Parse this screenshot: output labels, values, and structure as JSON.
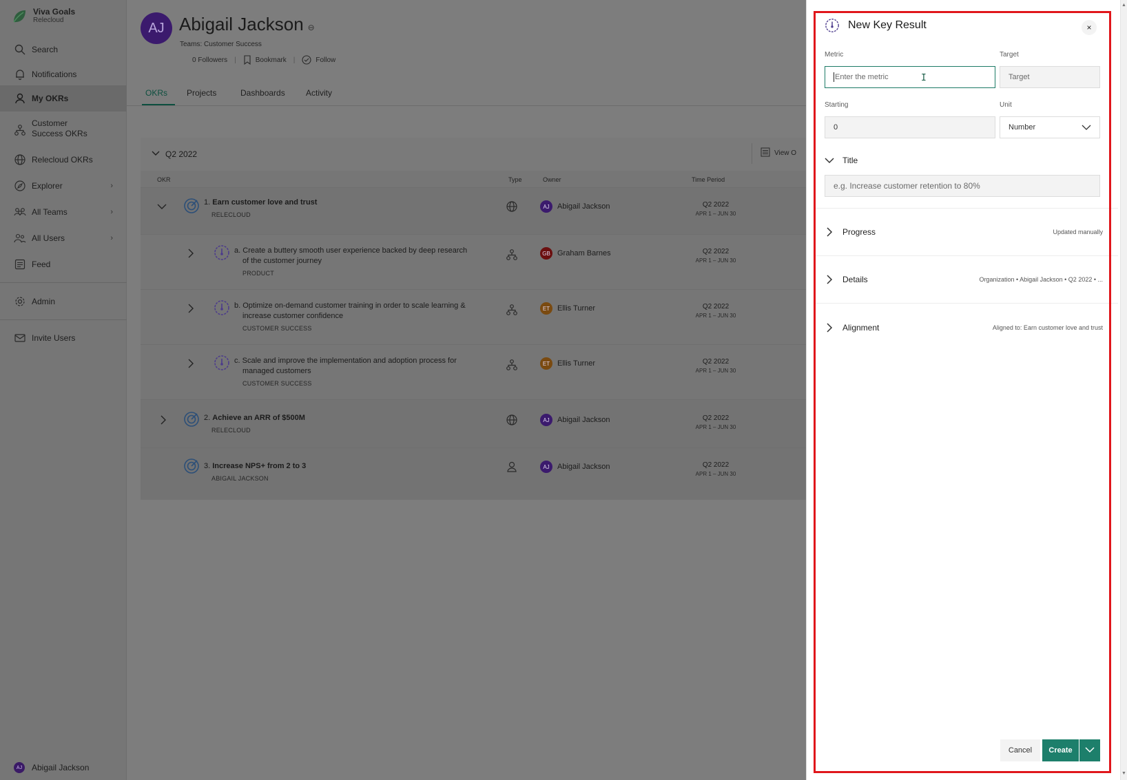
{
  "app": {
    "name": "Viva Goals",
    "tenant": "Relecloud",
    "brand_color": "#1d7f6b"
  },
  "sidebar": {
    "items": [
      {
        "label": "Search",
        "icon": "search-icon"
      },
      {
        "label": "Notifications",
        "icon": "bell-icon"
      },
      {
        "label": "My OKRs",
        "icon": "person-icon",
        "active": true
      },
      {
        "label": "Customer Success OKRs",
        "icon": "org-icon"
      },
      {
        "label": "Relecloud OKRs",
        "icon": "globe-icon"
      },
      {
        "label": "Explorer",
        "icon": "compass-icon",
        "has_chevron": true
      },
      {
        "label": "All Teams",
        "icon": "team-icon",
        "has_chevron": true
      },
      {
        "label": "All Users",
        "icon": "users-icon",
        "has_chevron": true
      },
      {
        "label": "Feed",
        "icon": "feed-icon"
      },
      {
        "label": "Admin",
        "icon": "gear-icon"
      },
      {
        "label": "Invite Users",
        "icon": "mail-icon"
      }
    ],
    "footer_user": {
      "name": "Abigail Jackson",
      "initials": "AJ"
    }
  },
  "profile": {
    "initials": "AJ",
    "name": "Abigail Jackson",
    "teams": "Teams: Customer Success",
    "followers": "0 Followers",
    "bookmark": "Bookmark",
    "follow": "Follow"
  },
  "tabs": [
    {
      "label": "OKRs",
      "active": true
    },
    {
      "label": "Projects"
    },
    {
      "label": "Dashboards"
    },
    {
      "label": "Activity"
    }
  ],
  "okr_table": {
    "period": "Q2 2022",
    "view_button": "View O",
    "columns": {
      "okr": "OKR",
      "type": "Type",
      "owner": "Owner",
      "time_period": "Time Period"
    },
    "rows": [
      {
        "index": "1.",
        "title": "Earn customer love and trust",
        "sub": "RELECLOUD",
        "type": "globe-icon",
        "owner": "Abigail Jackson",
        "owner_initials": "AJ",
        "owner_color": "#3b1a6d",
        "period": "Q2 2022",
        "range": "APR 1 – JUN 30"
      },
      {
        "index": "a.",
        "title_line1": "Create a buttery smooth user experience backed by deep research",
        "title_line2": "of the customer journey",
        "sub": "PRODUCT",
        "type": "org-icon",
        "owner": "Graham Barnes",
        "owner_initials": "GB",
        "owner_color": "#6b0f0f",
        "period": "Q2 2022",
        "range": "APR 1 – JUN 30"
      },
      {
        "index": "b.",
        "title_line1": "Optimize on-demand customer training in order to scale learning &",
        "title_line2": "increase customer confidence",
        "sub": "CUSTOMER SUCCESS",
        "type": "org-icon",
        "owner": "Ellis Turner",
        "owner_initials": "ET",
        "owner_color": "#7a4a10",
        "period": "Q2 2022",
        "range": "APR 1 – JUN 30"
      },
      {
        "index": "c.",
        "title_line1": "Scale and improve the implementation and adoption process for",
        "title_line2": "managed customers",
        "sub": "CUSTOMER SUCCESS",
        "type": "org-icon",
        "owner": "Ellis Turner",
        "owner_initials": "ET",
        "owner_color": "#7a4a10",
        "period": "Q2 2022",
        "range": "APR 1 – JUN 30"
      },
      {
        "index": "2.",
        "title": "Achieve an ARR of $500M",
        "sub": "RELECLOUD",
        "type": "globe-icon",
        "owner": "Abigail Jackson",
        "owner_initials": "AJ",
        "owner_color": "#3b1a6d",
        "period": "Q2 2022",
        "range": "APR 1 – JUN 30"
      },
      {
        "index": "3.",
        "title": "Increase NPS+ from 2 to 3",
        "sub": "ABIGAIL JACKSON",
        "type": "person-icon",
        "owner": "Abigail Jackson",
        "owner_initials": "AJ",
        "owner_color": "#3b1a6d",
        "period": "Q2 2022",
        "range": "APR 1 – JUN 30"
      }
    ]
  },
  "panel": {
    "title": "New Key Result",
    "close_label": "×",
    "metric": {
      "label": "Metric",
      "placeholder": "Enter the metric",
      "value": ""
    },
    "target": {
      "label": "Target",
      "placeholder": "Target"
    },
    "starting": {
      "label": "Starting",
      "value": "0"
    },
    "unit": {
      "label": "Unit",
      "value": "Number"
    },
    "title_section": {
      "label": "Title",
      "placeholder": "e.g. Increase customer retention to 80%"
    },
    "progress": {
      "label": "Progress",
      "value": "Updated manually"
    },
    "details": {
      "label": "Details",
      "value": "Organization • Abigail Jackson • Q2 2022 • ..."
    },
    "alignment": {
      "label": "Alignment",
      "value": "Aligned to: Earn customer love and trust"
    },
    "cancel_label": "Cancel",
    "create_label": "Create",
    "highlight_color": "#e0161b"
  }
}
